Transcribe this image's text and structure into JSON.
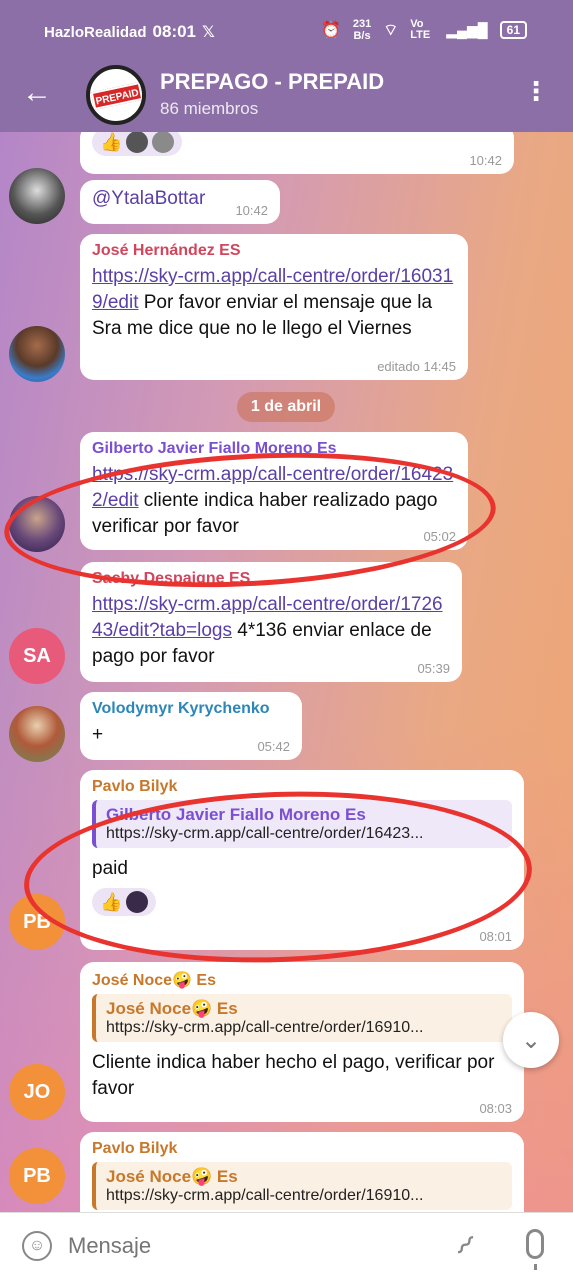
{
  "status_bar": {
    "carrier": "HazloRealidad",
    "time": "08:01",
    "x_icon": "x-logo",
    "speed_value": "231",
    "speed_unit": "B/s",
    "network": "Vo LTE",
    "battery": "61"
  },
  "header": {
    "title": "PREPAGO - PREPAID",
    "subtitle": "86 miembros",
    "avatar_text": "PREPAID"
  },
  "messages": [
    {
      "time": "10:42"
    },
    {
      "text": "@YtalaBottar",
      "time": "10:42"
    },
    {
      "sender": "José Hernández ES",
      "sender_color": "#d1455d",
      "link": "https://sky-crm.app/call-centre/order/160319/edit",
      "text": " Por favor enviar el mensaje que la Sra me dice que no le llego el Viernes",
      "time": "editado 14:45"
    },
    {
      "sender": "Gilberto Javier Fiallo Moreno Es",
      "sender_color": "#7a4fd1",
      "link": "https://sky-crm.app/call-centre/order/164232/edit",
      "text": " cliente indica haber realizado pago verificar por favor",
      "time": "05:02"
    },
    {
      "sender": "Sachy Despaigne ES",
      "sender_color": "#d1455d",
      "avatar": "SA",
      "link": "https://sky-crm.app/call-centre/order/172643/edit?tab=logs",
      "text": " 4*136 enviar enlace de pago por favor",
      "time": "05:39"
    },
    {
      "sender": "Volodymyr Kyrychenko",
      "sender_color": "#2d86b8",
      "text": "+",
      "time": "05:42"
    },
    {
      "sender": "Pavlo Bilyk",
      "sender_color": "#c7782a",
      "avatar": "PB",
      "reply_name": "Gilberto Javier Fiallo Moreno Es",
      "reply_text": "https://sky-crm.app/call-centre/order/16423...",
      "text": "paid",
      "time": "08:01"
    },
    {
      "sender": "José Noce🤪 Es",
      "sender_color": "#c7782a",
      "avatar": "JO",
      "reply_name": "José Noce🤪 Es",
      "reply_text": "https://sky-crm.app/call-centre/order/16910...",
      "text": "Cliente indica haber hecho el pago, verificar por favor",
      "time": "08:03"
    },
    {
      "sender": "Pavlo Bilyk",
      "sender_color": "#c7782a",
      "avatar": "PB",
      "reply_name": "José Noce🤪 Es",
      "reply_text": "https://sky-crm.app/call-centre/order/16910..."
    }
  ],
  "date_separator": "1 de abril",
  "input": {
    "placeholder": "Mensaje"
  },
  "colors": {
    "header": "#8c6fa6",
    "annotation": "#e8332f",
    "link": "#5a3fa6"
  }
}
